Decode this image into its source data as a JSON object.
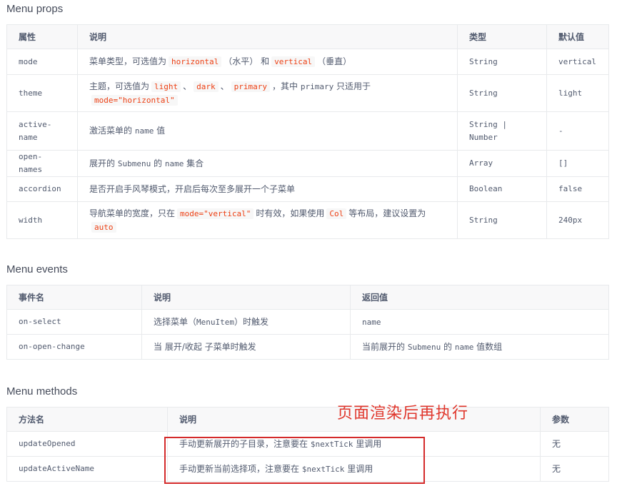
{
  "props": {
    "title": "Menu props",
    "headers": [
      "属性",
      "说明",
      "类型",
      "默认值"
    ],
    "rows": [
      {
        "name": "mode",
        "desc": [
          {
            "t": "菜单类型，可选值为"
          },
          {
            "c": "horizontal"
          },
          {
            "t": "（水平） 和"
          },
          {
            "c": "vertical"
          },
          {
            "t": "（垂直）"
          }
        ],
        "type": "String",
        "default": "vertical"
      },
      {
        "name": "theme",
        "desc": [
          {
            "t": "主题，可选值为"
          },
          {
            "c": "light"
          },
          {
            "t": "、"
          },
          {
            "c": "dark"
          },
          {
            "t": "、"
          },
          {
            "c": "primary"
          },
          {
            "t": "，其中 "
          },
          {
            "p": "primary"
          },
          {
            "t": " 只适用于 "
          },
          {
            "c": "mode=\"horizontal\""
          }
        ],
        "type": "String",
        "default": "light"
      },
      {
        "name": "active-name",
        "desc": [
          {
            "t": "激活菜单的 "
          },
          {
            "p": "name"
          },
          {
            "t": " 值"
          }
        ],
        "type": "String | Number",
        "default": "-"
      },
      {
        "name": "open-names",
        "desc": [
          {
            "t": "展开的 "
          },
          {
            "p": "Submenu"
          },
          {
            "t": " 的 "
          },
          {
            "p": "name"
          },
          {
            "t": " 集合"
          }
        ],
        "type": "Array",
        "default": "[]"
      },
      {
        "name": "accordion",
        "desc": [
          {
            "t": "是否开启手风琴模式，开启后每次至多展开一个子菜单"
          }
        ],
        "type": "Boolean",
        "default": "false"
      },
      {
        "name": "width",
        "desc": [
          {
            "t": "导航菜单的宽度，只在"
          },
          {
            "c": "mode=\"vertical\""
          },
          {
            "t": "时有效，如果使用"
          },
          {
            "c": "Col"
          },
          {
            "t": "等布局，建议设置为"
          },
          {
            "c": "auto"
          }
        ],
        "type": "String",
        "default": "240px"
      }
    ]
  },
  "events": {
    "title": "Menu events",
    "headers": [
      "事件名",
      "说明",
      "返回值"
    ],
    "rows": [
      {
        "name": "on-select",
        "desc": [
          {
            "t": "选择菜单（"
          },
          {
            "p": "MenuItem"
          },
          {
            "t": "）时触发"
          }
        ],
        "ret": [
          {
            "p": "name"
          }
        ]
      },
      {
        "name": "on-open-change",
        "desc": [
          {
            "t": "当 展开/收起 子菜单时触发"
          }
        ],
        "ret": [
          {
            "t": "当前展开的 "
          },
          {
            "p": "Submenu"
          },
          {
            "t": " 的 "
          },
          {
            "p": "name"
          },
          {
            "t": " 值数组"
          }
        ]
      }
    ]
  },
  "methods": {
    "title": "Menu methods",
    "headers": [
      "方法名",
      "说明",
      "参数"
    ],
    "rows": [
      {
        "name": "updateOpened",
        "desc": [
          {
            "t": "手动更新展开的子目录，注意要在 "
          },
          {
            "p": "$nextTick"
          },
          {
            "t": " 里调用"
          }
        ],
        "param": "无"
      },
      {
        "name": "updateActiveName",
        "desc": [
          {
            "t": "手动更新当前选择项，注意要在 "
          },
          {
            "p": "$nextTick"
          },
          {
            "t": " 里调用"
          }
        ],
        "param": "无"
      }
    ]
  },
  "annotation": {
    "text": "页面渲染后再执行",
    "color": "#e0362c"
  }
}
